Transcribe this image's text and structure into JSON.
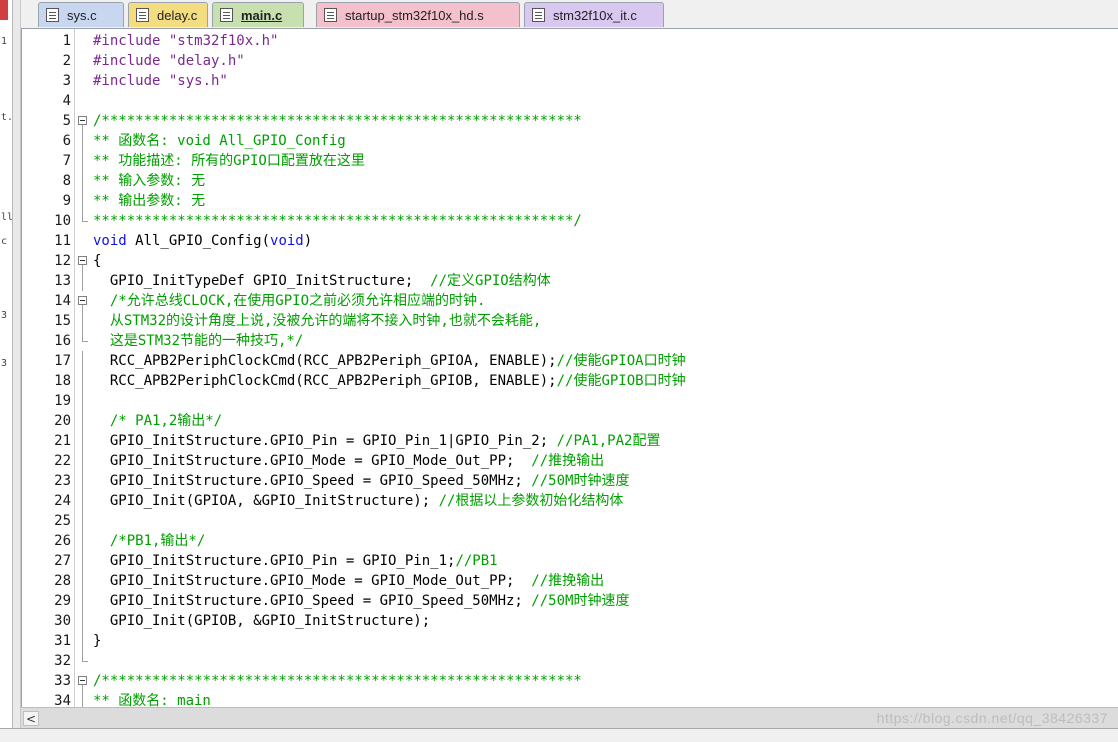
{
  "tabs": [
    {
      "label": "sys.c",
      "color": "#c8d6f0",
      "active": false
    },
    {
      "label": "delay.c",
      "color": "#f4dc80",
      "active": false
    },
    {
      "label": "main.c",
      "color": "#c8e0b0",
      "active": true
    },
    {
      "label": "startup_stm32f10x_hd.s",
      "color": "#f4c0cc",
      "active": false
    },
    {
      "label": "stm32f10x_it.c",
      "color": "#d8c8f0",
      "active": false
    }
  ],
  "left_pane_marks": [
    "1",
    "t.",
    "ll",
    "c",
    "3",
    "3"
  ],
  "code_lines": [
    {
      "n": "1",
      "fold": "",
      "t": [
        [
          "#include ",
          "pp"
        ],
        [
          "\"stm32f10x.h\"",
          "str"
        ]
      ]
    },
    {
      "n": "2",
      "fold": "",
      "t": [
        [
          "#include ",
          "pp"
        ],
        [
          "\"delay.h\"",
          "str"
        ]
      ]
    },
    {
      "n": "3",
      "fold": "",
      "t": [
        [
          "#include ",
          "pp"
        ],
        [
          "\"sys.h\"",
          "str"
        ]
      ]
    },
    {
      "n": "4",
      "fold": "",
      "t": []
    },
    {
      "n": "5",
      "fold": "start",
      "t": [
        [
          "/*********************************************************",
          "cm"
        ]
      ]
    },
    {
      "n": "6",
      "fold": "mid",
      "t": [
        [
          "** 函数名: void All_GPIO_Config",
          "cm"
        ]
      ]
    },
    {
      "n": "7",
      "fold": "mid",
      "t": [
        [
          "** 功能描述: 所有的GPIO口配置放在这里",
          "cm"
        ]
      ]
    },
    {
      "n": "8",
      "fold": "mid",
      "t": [
        [
          "** 输入参数: 无",
          "cm"
        ]
      ]
    },
    {
      "n": "9",
      "fold": "mid",
      "t": [
        [
          "** 输出参数: 无",
          "cm"
        ]
      ]
    },
    {
      "n": "10",
      "fold": "end",
      "t": [
        [
          "*********************************************************/",
          "cm"
        ]
      ]
    },
    {
      "n": "11",
      "fold": "",
      "t": [
        [
          "void",
          "kw"
        ],
        [
          " All_GPIO_Config(",
          ""
        ],
        [
          "void",
          "kw"
        ],
        [
          ")",
          ""
        ]
      ]
    },
    {
      "n": "12",
      "fold": "start",
      "t": [
        [
          "{",
          ""
        ]
      ]
    },
    {
      "n": "13",
      "fold": "mid",
      "t": [
        [
          "  GPIO_InitTypeDef GPIO_InitStructure;  ",
          ""
        ],
        [
          "//定义GPIO结构体",
          "cm"
        ]
      ]
    },
    {
      "n": "14",
      "fold": "start",
      "t": [
        [
          "  /*允许总线CLOCK,在使用GPIO之前必须允许相应端的时钟.",
          "cm"
        ]
      ]
    },
    {
      "n": "15",
      "fold": "mid",
      "t": [
        [
          "  从STM32的设计角度上说,没被允许的端将不接入时钟,也就不会耗能,",
          "cm"
        ]
      ]
    },
    {
      "n": "16",
      "fold": "end",
      "t": [
        [
          "  这是STM32节能的一种技巧,*/",
          "cm"
        ]
      ]
    },
    {
      "n": "17",
      "fold": "mid",
      "t": [
        [
          "  RCC_APB2PeriphClockCmd(RCC_APB2Periph_GPIOA, ENABLE);",
          ""
        ],
        [
          "//使能GPIOA口时钟",
          "cm"
        ]
      ]
    },
    {
      "n": "18",
      "fold": "mid",
      "t": [
        [
          "  RCC_APB2PeriphClockCmd(RCC_APB2Periph_GPIOB, ENABLE);",
          ""
        ],
        [
          "//使能GPIOB口时钟",
          "cm"
        ]
      ]
    },
    {
      "n": "19",
      "fold": "mid",
      "t": []
    },
    {
      "n": "20",
      "fold": "mid",
      "t": [
        [
          "  /* PA1,2输出*/",
          "cm"
        ]
      ]
    },
    {
      "n": "21",
      "fold": "mid",
      "t": [
        [
          "  GPIO_InitStructure.GPIO_Pin = GPIO_Pin_1|GPIO_Pin_2; ",
          ""
        ],
        [
          "//PA1,PA2配置",
          "cm"
        ]
      ]
    },
    {
      "n": "22",
      "fold": "mid",
      "t": [
        [
          "  GPIO_InitStructure.GPIO_Mode = GPIO_Mode_Out_PP;  ",
          ""
        ],
        [
          "//推挽输出",
          "cm"
        ]
      ]
    },
    {
      "n": "23",
      "fold": "mid",
      "t": [
        [
          "  GPIO_InitStructure.GPIO_Speed = GPIO_Speed_50MHz; ",
          ""
        ],
        [
          "//50M时钟速度",
          "cm"
        ]
      ]
    },
    {
      "n": "24",
      "fold": "mid",
      "t": [
        [
          "  GPIO_Init(GPIOA, &GPIO_InitStructure); ",
          ""
        ],
        [
          "//根据以上参数初始化结构体",
          "cm"
        ]
      ]
    },
    {
      "n": "25",
      "fold": "mid",
      "t": []
    },
    {
      "n": "26",
      "fold": "mid",
      "t": [
        [
          "  /*PB1,输出*/",
          "cm"
        ]
      ]
    },
    {
      "n": "27",
      "fold": "mid",
      "t": [
        [
          "  GPIO_InitStructure.GPIO_Pin = GPIO_Pin_1;",
          ""
        ],
        [
          "//PB1",
          "cm"
        ]
      ]
    },
    {
      "n": "28",
      "fold": "mid",
      "t": [
        [
          "  GPIO_InitStructure.GPIO_Mode = GPIO_Mode_Out_PP;  ",
          ""
        ],
        [
          "//推挽输出",
          "cm"
        ]
      ]
    },
    {
      "n": "29",
      "fold": "mid",
      "t": [
        [
          "  GPIO_InitStructure.GPIO_Speed = GPIO_Speed_50MHz; ",
          ""
        ],
        [
          "//50M时钟速度",
          "cm"
        ]
      ]
    },
    {
      "n": "30",
      "fold": "mid",
      "t": [
        [
          "  GPIO_Init(GPIOB, &GPIO_InitStructure);",
          ""
        ]
      ]
    },
    {
      "n": "31",
      "fold": "mid",
      "t": [
        [
          "}",
          ""
        ]
      ]
    },
    {
      "n": "32",
      "fold": "end",
      "t": []
    },
    {
      "n": "33",
      "fold": "start",
      "t": [
        [
          "/*********************************************************",
          "cm"
        ]
      ]
    },
    {
      "n": "34",
      "fold": "mid",
      "t": [
        [
          "** 函数名: main",
          "cm"
        ]
      ]
    }
  ],
  "scrollbar": {
    "left_arrow": "<"
  },
  "watermark": "https://blog.csdn.net/qq_38426337",
  "icons": [
    "file-icon",
    "fold-collapse-icon",
    "scroll-left-arrow-icon"
  ]
}
